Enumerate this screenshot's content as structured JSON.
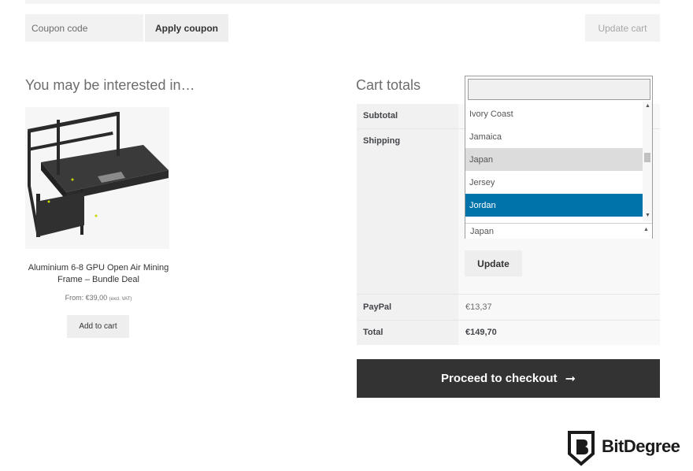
{
  "coupon": {
    "placeholder": "Coupon code",
    "apply_label": "Apply coupon",
    "update_cart_label": "Update cart"
  },
  "interest": {
    "heading": "You may be interested in…",
    "product": {
      "title": "Aluminium 6-8 GPU Open Air Mining Frame – Bundle Deal",
      "price": "From: €39,00",
      "price_note": "(excl. VAT)",
      "add_to_cart_label": "Add to cart"
    }
  },
  "cart_totals": {
    "heading": "Cart totals",
    "subtotal_label": "Subtotal",
    "shipping_label": "Shipping",
    "paypal_label": "PayPal",
    "paypal_value": "€13,37",
    "total_label": "Total",
    "total_value": "€149,70",
    "update_label": "Update",
    "checkout_label": "Proceed to checkout",
    "checkout_arrow": "➞"
  },
  "country_dropdown": {
    "search_value": "",
    "options": [
      "Ivory Coast",
      "Jamaica",
      "Japan",
      "Jersey",
      "Jordan"
    ],
    "hovered": "Japan",
    "highlighted": "Jordan",
    "selected_value": "Japan"
  },
  "brand": {
    "name": "BitDegree"
  },
  "colors": {
    "accent_blue": "#0073aa",
    "checkout_dark": "#333333"
  }
}
